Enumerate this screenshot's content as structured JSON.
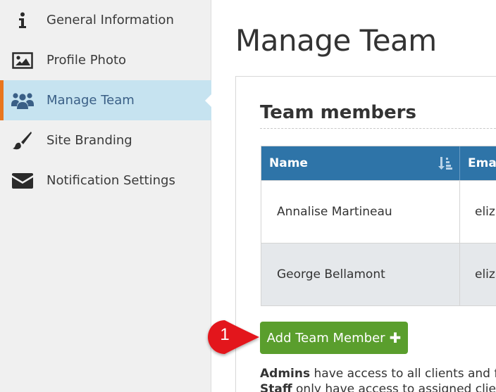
{
  "sidebar": {
    "items": [
      {
        "label": "General Information",
        "icon": "info-icon"
      },
      {
        "label": "Profile Photo",
        "icon": "image-icon"
      },
      {
        "label": "Manage Team",
        "icon": "team-icon",
        "active": true
      },
      {
        "label": "Site Branding",
        "icon": "paintbrush-icon"
      },
      {
        "label": "Notification Settings",
        "icon": "envelope-icon"
      }
    ]
  },
  "main": {
    "title": "Manage Team",
    "panel_title": "Team members",
    "table": {
      "columns": [
        "Name",
        "Email"
      ],
      "rows": [
        {
          "name": "Annalise Martineau",
          "email": "eliza"
        },
        {
          "name": "George Bellamont",
          "email": "eliza"
        }
      ]
    },
    "add_button_label": "Add Team Member",
    "callout_number": "1",
    "note": {
      "line1_bold": "Admins",
      "line1_text": " have access to all clients and firm",
      "line2_bold": "Staff",
      "line2_text": " only have access to assigned clients"
    }
  },
  "colors": {
    "accent": "#e8761e",
    "active_bg": "#c6e3f0",
    "table_header": "#2e74a8",
    "button": "#5a9e2d",
    "callout": "#e3161c"
  }
}
